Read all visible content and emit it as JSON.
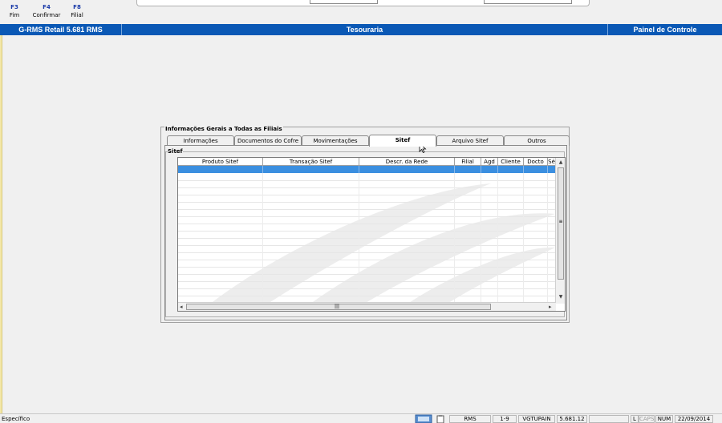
{
  "toolbar": {
    "keys": [
      {
        "key": "F3",
        "label": "Fim"
      },
      {
        "key": "F4",
        "label": "Confirmar"
      },
      {
        "key": "F8",
        "label": "Filial"
      }
    ]
  },
  "titlebar": {
    "app": "G-RMS Retail 5.681 RMS",
    "module": "Tesouraria",
    "panel": "Painel de Controle"
  },
  "panel": {
    "title": "Informações Gerais a Todas as Filiais",
    "tabs": [
      "Informações",
      "Documentos do Cofre",
      "Movimentações",
      "Sitef",
      "Arquivo Sitef",
      "Outros"
    ],
    "active_tab": "Sitef",
    "group_title": "Sitef"
  },
  "grid": {
    "columns": [
      "Produto Sitef",
      "Transação Sitef",
      "Descr. da Rede",
      "Filial",
      "Agd",
      "Cliente",
      "Docto",
      "Sé"
    ]
  },
  "statusbar": {
    "text": "Específico",
    "fields": [
      "RMS",
      "1-9",
      "VGTUPAIN",
      "5.681.12",
      "",
      "L",
      "CAPS",
      "NUM",
      "22/09/2014"
    ]
  }
}
